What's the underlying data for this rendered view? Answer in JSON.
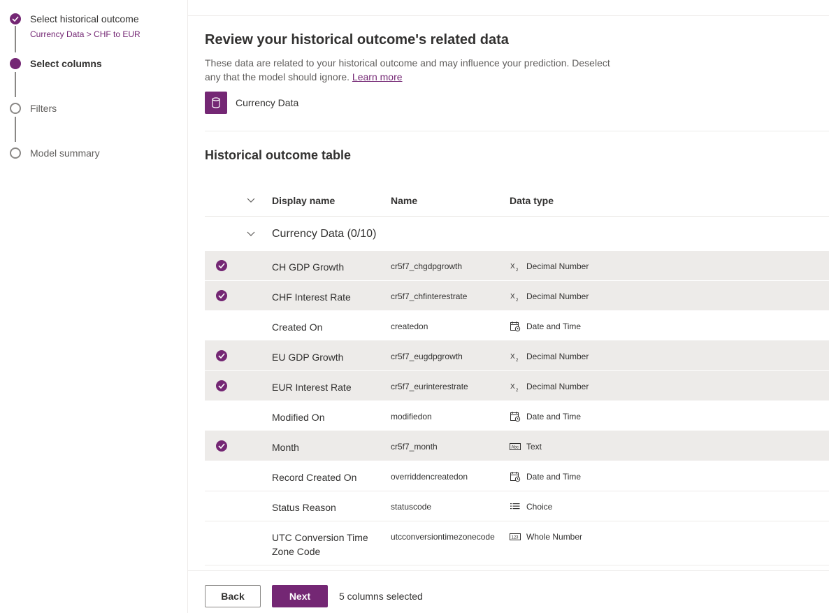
{
  "stepper": {
    "steps": [
      {
        "label": "Select historical outcome",
        "sub": "Currency Data > CHF to EUR",
        "state": "done"
      },
      {
        "label": "Select columns",
        "state": "current"
      },
      {
        "label": "Filters",
        "state": "todo"
      },
      {
        "label": "Model summary",
        "state": "todo"
      }
    ]
  },
  "main": {
    "title": "Review your historical outcome's related data",
    "description": "These data are related to your historical outcome and may influence your prediction. Deselect any that the model should ignore.",
    "learn_more": "Learn more",
    "entity": {
      "name": "Currency Data",
      "icon": "database-icon"
    },
    "section_title": "Historical outcome table"
  },
  "table": {
    "headers": {
      "display_name": "Display name",
      "name": "Name",
      "data_type": "Data type"
    },
    "group": {
      "label": "Currency Data (0/10)"
    },
    "rows": [
      {
        "display": "CH GDP Growth",
        "name": "cr5f7_chgdpgrowth",
        "type": "Decimal Number",
        "icon": "decimal-icon",
        "selected": true
      },
      {
        "display": "CHF Interest Rate",
        "name": "cr5f7_chfinterestrate",
        "type": "Decimal Number",
        "icon": "decimal-icon",
        "selected": true
      },
      {
        "display": "Created On",
        "name": "createdon",
        "type": "Date and Time",
        "icon": "calendar-icon",
        "selected": false
      },
      {
        "display": "EU GDP Growth",
        "name": "cr5f7_eugdpgrowth",
        "type": "Decimal Number",
        "icon": "decimal-icon",
        "selected": true
      },
      {
        "display": "EUR Interest Rate",
        "name": "cr5f7_eurinterestrate",
        "type": "Decimal Number",
        "icon": "decimal-icon",
        "selected": true
      },
      {
        "display": "Modified On",
        "name": "modifiedon",
        "type": "Date and Time",
        "icon": "calendar-icon",
        "selected": false
      },
      {
        "display": "Month",
        "name": "cr5f7_month",
        "type": "Text",
        "icon": "text-icon",
        "selected": true
      },
      {
        "display": "Record Created On",
        "name": "overriddencreatedon",
        "type": "Date and Time",
        "icon": "calendar-icon",
        "selected": false
      },
      {
        "display": "Status Reason",
        "name": "statuscode",
        "type": "Choice",
        "icon": "choice-icon",
        "selected": false
      },
      {
        "display": "UTC Conversion Time Zone Code",
        "name": "utcconversiontimezonecode",
        "type": "Whole Number",
        "icon": "whole-number-icon",
        "selected": false
      }
    ]
  },
  "footer": {
    "back_label": "Back",
    "next_label": "Next",
    "selected_count": "5 columns selected"
  },
  "colors": {
    "accent": "#742774",
    "selected_row": "#edebe9"
  }
}
